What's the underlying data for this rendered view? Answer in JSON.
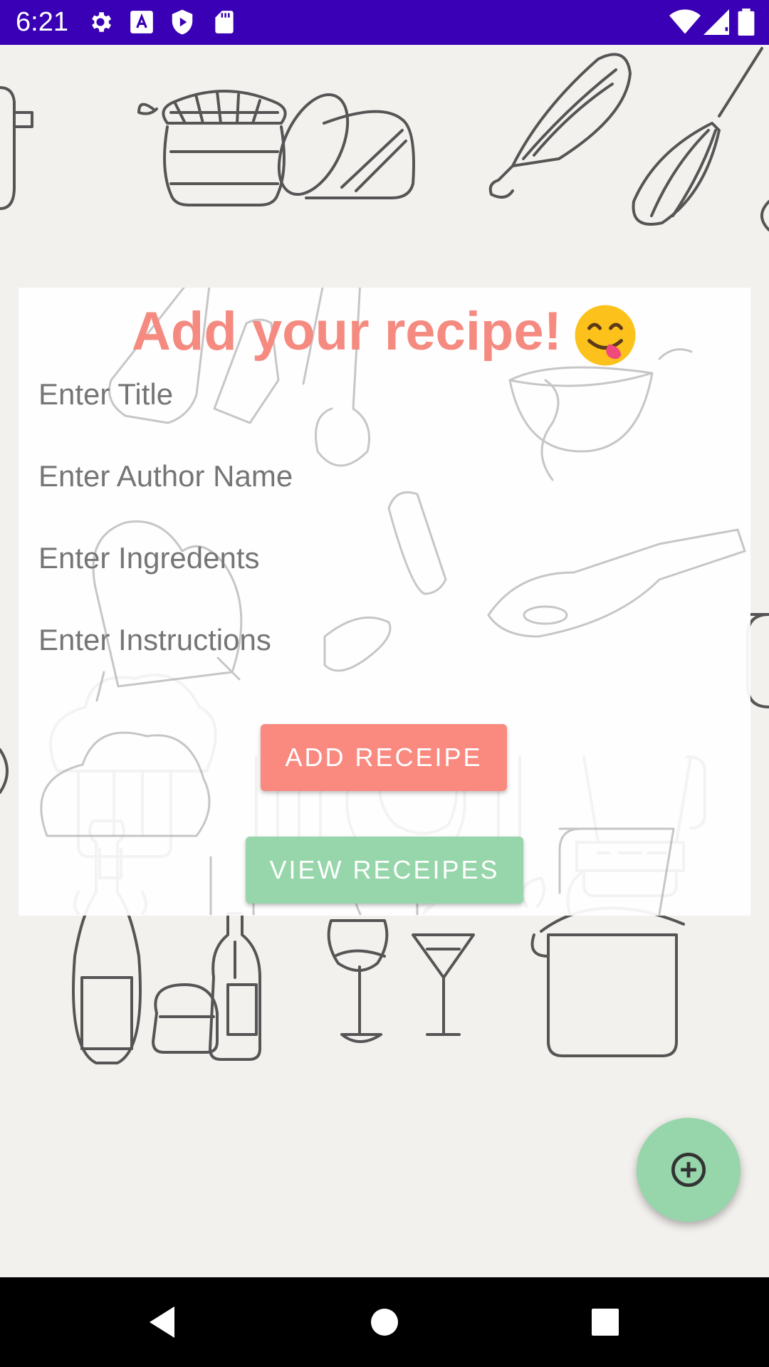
{
  "status_bar": {
    "time": "6:21",
    "left_icons": [
      "gear-icon",
      "font-a-icon",
      "shield-play-icon",
      "sd-card-icon"
    ],
    "right_icons": [
      "wifi-icon",
      "signal-icon",
      "battery-icon"
    ],
    "background_color": "#3a00b5"
  },
  "form": {
    "title": "Add your recipe!",
    "title_emoji": "😋",
    "title_color": "#f58a80",
    "fields": {
      "title_placeholder": "Enter Title",
      "author_placeholder": "Enter Author Name",
      "ingredients_placeholder": "Enter Ingredents",
      "instructions_placeholder": "Enter Instructions"
    },
    "add_button_label": "ADD RECEIPE",
    "view_button_label": "VIEW RECEIPES",
    "add_button_color": "#fa8a80",
    "view_button_color": "#96d6aa"
  },
  "fab": {
    "icon": "add-circle-icon",
    "color": "#96d6aa"
  },
  "nav_bar": {
    "buttons": [
      "back-icon",
      "home-icon",
      "recents-icon"
    ]
  }
}
